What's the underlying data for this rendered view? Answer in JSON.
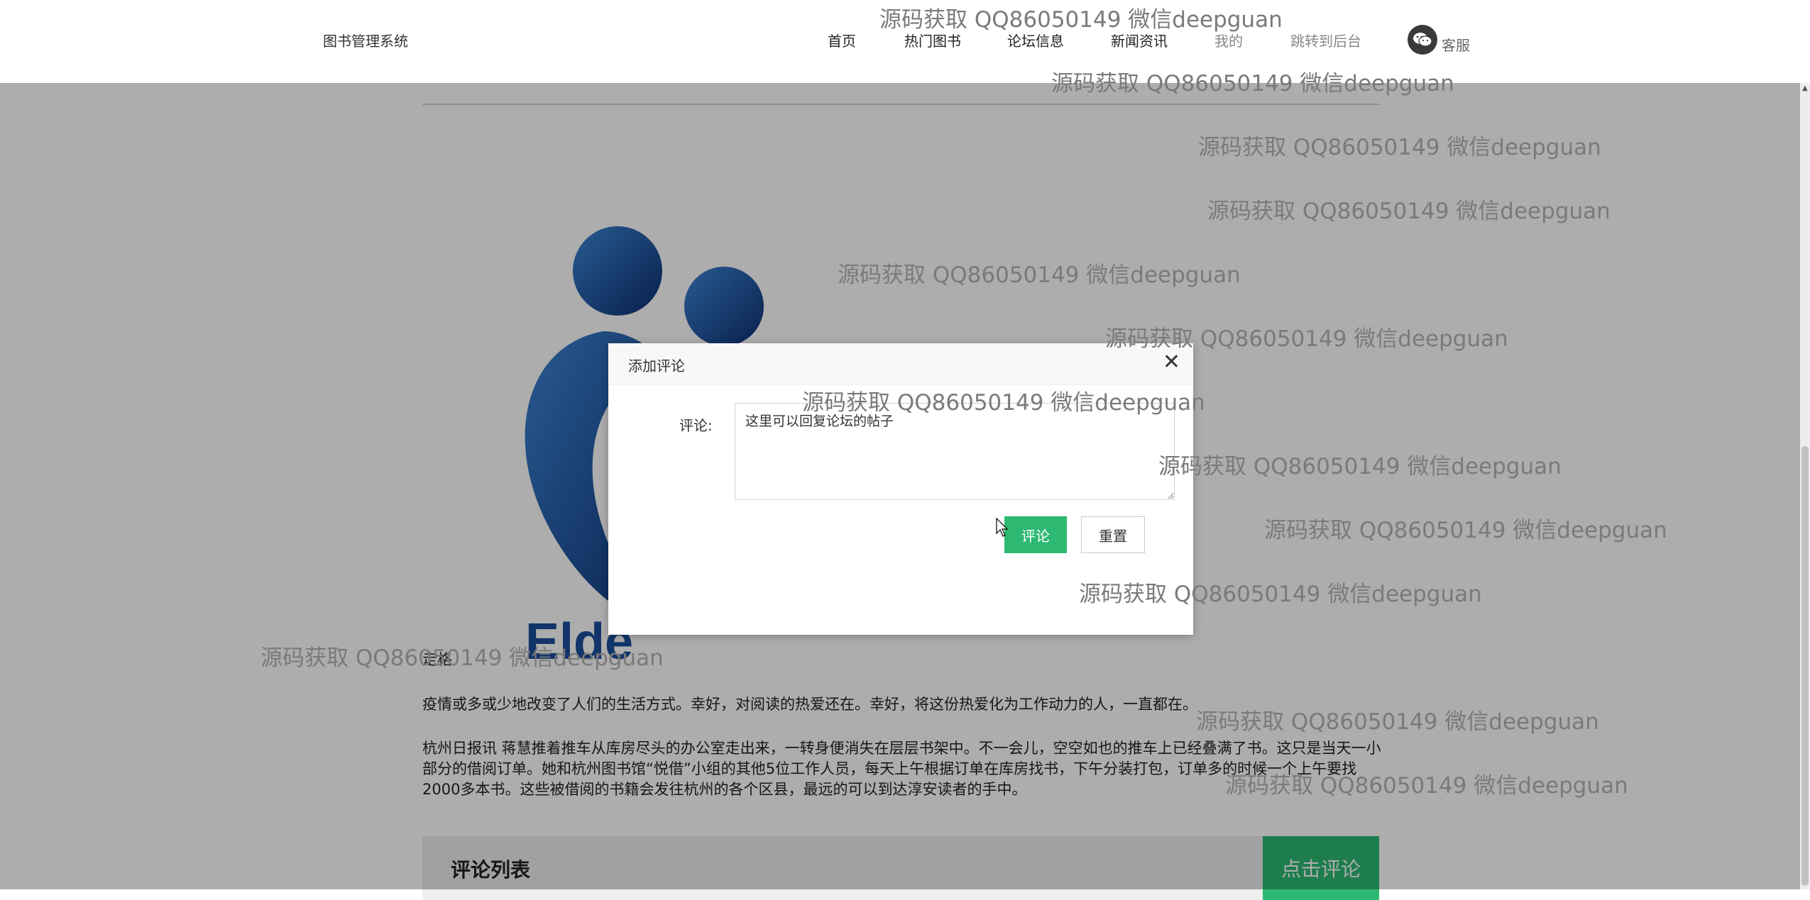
{
  "nav": {
    "brand": "图书管理系统",
    "items": [
      {
        "label": "首页"
      },
      {
        "label": "热门图书"
      },
      {
        "label": "论坛信息"
      },
      {
        "label": "新闻资讯"
      },
      {
        "label": "我的"
      },
      {
        "label": "跳转到后台"
      }
    ],
    "service_label": "客服"
  },
  "article": {
    "logo_text": "Elde",
    "author": "走格",
    "p1": "疫情或多或少地改变了人们的生活方式。幸好，对阅读的热爱还在。幸好，将这份热爱化为工作动力的人，一直都在。",
    "p2": "杭州日报讯 蒋慧推着推车从库房尽头的办公室走出来，一转身便消失在层层书架中。不一会儿，空空如也的推车上已经叠满了书。这只是当天一小部分的借阅订单。她和杭州图书馆“悦借”小组的其他5位工作人员，每天上午根据订单在库房找书，下午分装打包，订单多的时候一个上午要找2000多本书。这些被借阅的书籍会发往杭州的各个区县，最远的可以到达淳安读者的手中。"
  },
  "comments": {
    "title": "评论列表",
    "button": "点击评论"
  },
  "dialog": {
    "title": "添加评论",
    "label": "评论:",
    "textarea_value": "这里可以回复论坛的帖子",
    "submit": "评论",
    "reset": "重置"
  },
  "watermark": "源码获取 QQ86050149 微信deepguan",
  "colors": {
    "accent": "#2db972",
    "logo_blue": "#1a4f9c"
  },
  "icons": [
    "wechat-icon",
    "close-icon",
    "resize-icon",
    "mouse-cursor-icon"
  ]
}
